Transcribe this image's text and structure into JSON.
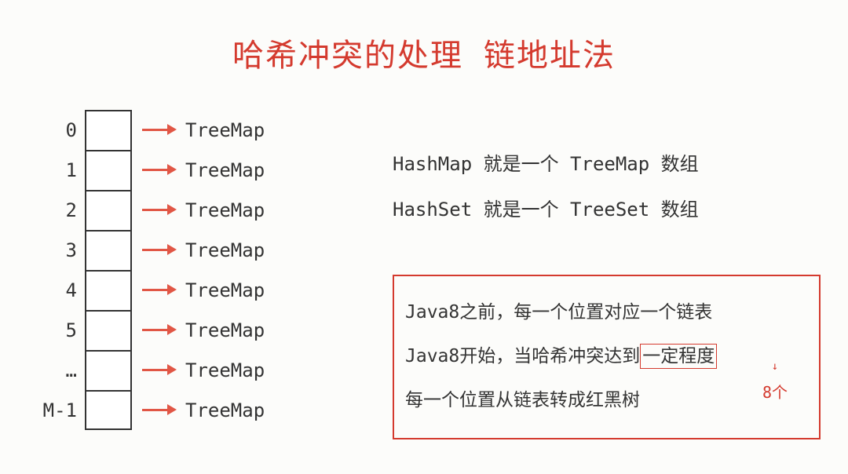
{
  "title": "哈希冲突的处理 链地址法",
  "rows": [
    {
      "index": "0",
      "label": "TreeMap"
    },
    {
      "index": "1",
      "label": "TreeMap"
    },
    {
      "index": "2",
      "label": "TreeMap"
    },
    {
      "index": "3",
      "label": "TreeMap"
    },
    {
      "index": "4",
      "label": "TreeMap"
    },
    {
      "index": "5",
      "label": "TreeMap"
    },
    {
      "index": "…",
      "label": "TreeMap"
    },
    {
      "index": "M-1",
      "label": "TreeMap"
    }
  ],
  "right_top": {
    "line1": "HashMap 就是一个 TreeMap 数组",
    "line2": "HashSet 就是一个 TreeSet 数组"
  },
  "red_box": {
    "line1": "Java8之前，每一个位置对应一个链表",
    "line2_prefix": "Java8开始，当哈希冲突达到",
    "line2_boxed": "一定程度",
    "line3": "每一个位置从链表转成红黑树"
  },
  "annotation": "8个"
}
